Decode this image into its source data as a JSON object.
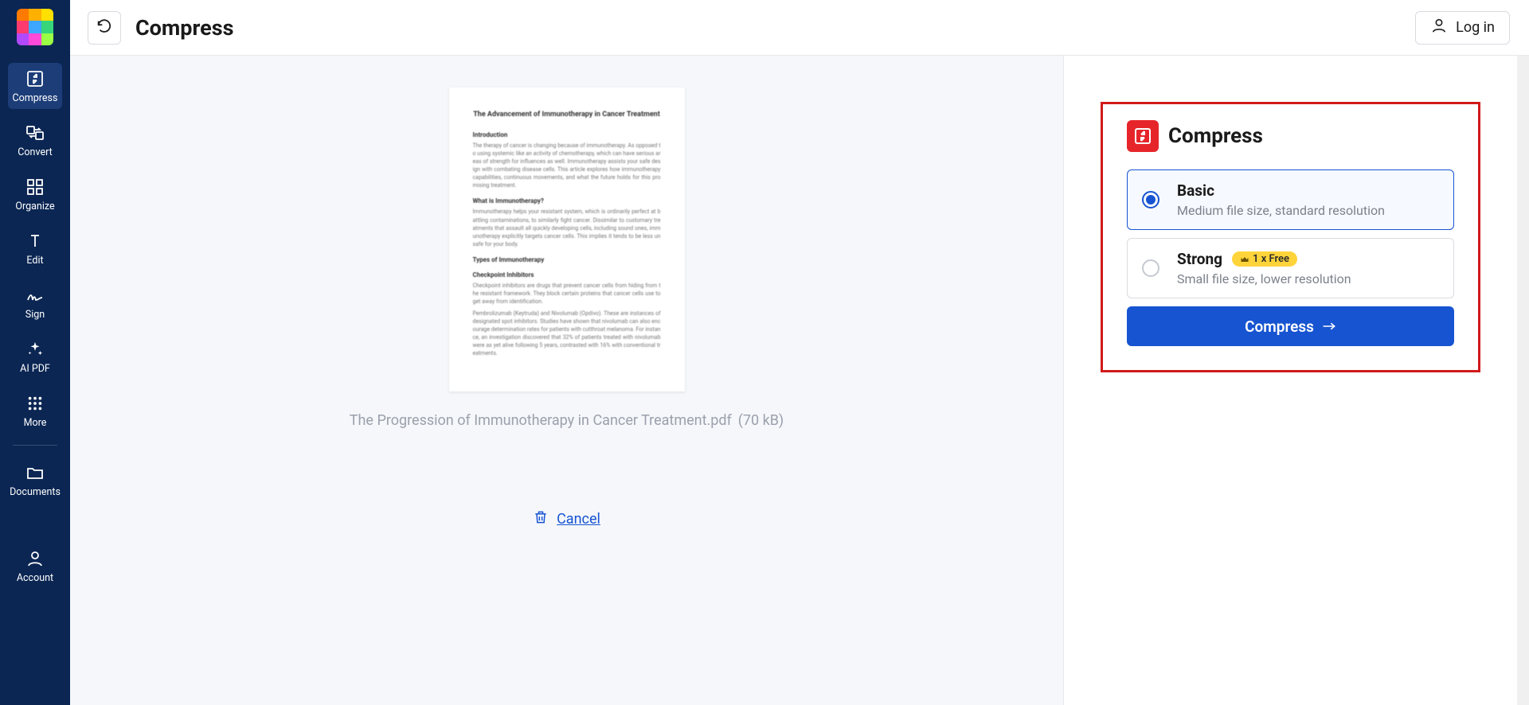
{
  "header": {
    "title": "Compress",
    "login_label": "Log in"
  },
  "sidebar": {
    "items": [
      {
        "label": "Compress"
      },
      {
        "label": "Convert"
      },
      {
        "label": "Organize"
      },
      {
        "label": "Edit"
      },
      {
        "label": "Sign"
      },
      {
        "label": "AI PDF"
      },
      {
        "label": "More"
      }
    ],
    "documents_label": "Documents",
    "account_label": "Account"
  },
  "preview": {
    "doc_title": "The Advancement of Immunotherapy in Cancer Treatment",
    "filename": "The Progression of Immunotherapy in Cancer Treatment.pdf",
    "filesize": "(70 kB)",
    "cancel_label": "Cancel"
  },
  "panel": {
    "title": "Compress",
    "options": [
      {
        "title": "Basic",
        "desc": "Medium file size, standard resolution",
        "selected": true
      },
      {
        "title": "Strong",
        "desc": "Small file size, lower resolution",
        "badge": "1 x Free"
      }
    ],
    "action_label": "Compress"
  }
}
